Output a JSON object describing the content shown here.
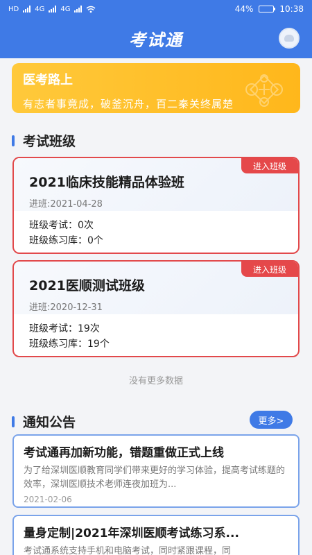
{
  "status_bar": {
    "carrier_labels": [
      "HD",
      "4G",
      "4G"
    ],
    "battery_percent": "44%",
    "battery_level": 0.44,
    "time": "10:38"
  },
  "header": {
    "title": "考试通"
  },
  "banner": {
    "title": "医考路上",
    "subtitle": "有志者事竟成，破釜沉舟，百二秦关终属楚"
  },
  "classes_section": {
    "title": "考试班级",
    "enter_label": "进入班级",
    "items": [
      {
        "name": "2021临床技能精品体验班",
        "join_date": "进班:2021-04-28",
        "exam_line": "班级考试：0次",
        "practice_line": "班级练习库：0个"
      },
      {
        "name": "2021医顺测试班级",
        "join_date": "进班:2020-12-31",
        "exam_line": "班级考试：19次",
        "practice_line": "班级练习库：19个"
      }
    ],
    "no_more_text": "没有更多数据"
  },
  "notice_section": {
    "title": "通知公告",
    "more_label": "更多>",
    "items": [
      {
        "title": "考试通再加新功能，错题重做正式上线",
        "body": "为了给深圳医顺教育同学们带来更好的学习体验，提高考试练题的效率，深圳医顺技术老师连夜加班为...",
        "date": "2021-02-06"
      },
      {
        "title": "量身定制|2021年深圳医顺考试练习系...",
        "body": "考试通系统支持手机和电脑考试，同时紧跟课程，同",
        "date": ""
      }
    ]
  },
  "colors": {
    "primary": "#3f7ae6",
    "accent_red": "#e5484a",
    "banner_yellow": "#ffbf2a"
  }
}
